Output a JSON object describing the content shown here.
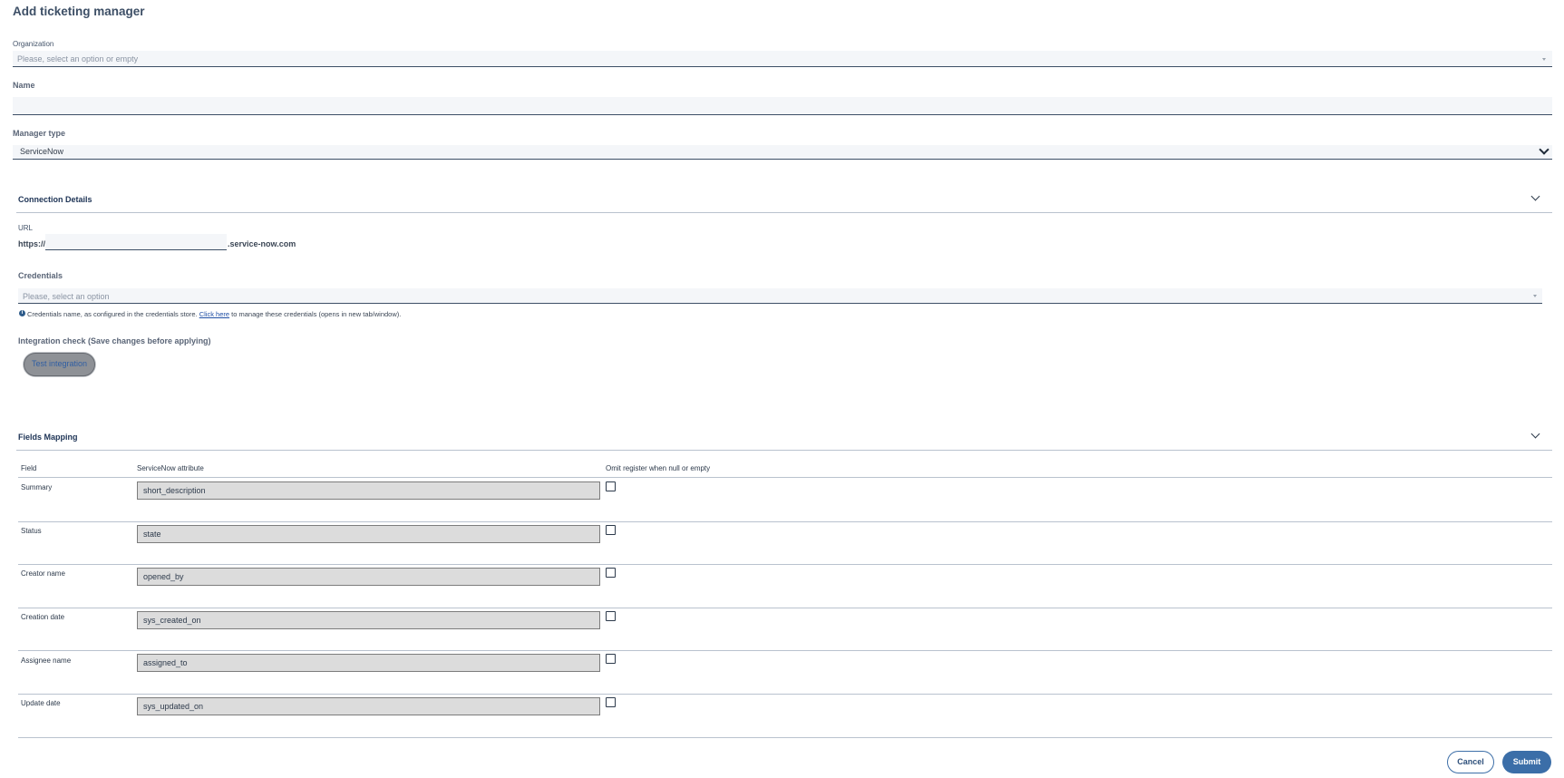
{
  "page": {
    "title": "Add ticketing manager"
  },
  "organization": {
    "label": "Organization",
    "placeholder": "Please, select an option or empty"
  },
  "name": {
    "label": "Name",
    "value": ""
  },
  "manager_type": {
    "label": "Manager type",
    "value": "ServiceNow"
  },
  "connection": {
    "title": "Connection Details",
    "url_label": "URL",
    "url_prefix": "https://",
    "url_value": "",
    "url_suffix": ".service-now.com",
    "credentials_label": "Credentials",
    "credentials_placeholder": "Please, select an option",
    "help_before": "Credentials name, as configured in the credentials store.",
    "help_link": "Click here",
    "help_after": "to manage these credentials (opens in new tab/window).",
    "integration_label": "Integration check (Save changes before applying)",
    "test_button": "Test integration"
  },
  "mapping": {
    "title": "Fields Mapping",
    "columns": [
      "Field",
      "ServiceNow attribute",
      "Omit register when null or empty"
    ],
    "rows": [
      {
        "field": "Summary",
        "attribute": "short_description",
        "omit": false
      },
      {
        "field": "Status",
        "attribute": "state",
        "omit": false
      },
      {
        "field": "Creator name",
        "attribute": "opened_by",
        "omit": false
      },
      {
        "field": "Creation date",
        "attribute": "sys_created_on",
        "omit": false
      },
      {
        "field": "Assignee name",
        "attribute": "assigned_to",
        "omit": false
      },
      {
        "field": "Update date",
        "attribute": "sys_updated_on",
        "omit": false
      }
    ]
  },
  "footer": {
    "cancel": "Cancel",
    "submit": "Submit"
  }
}
